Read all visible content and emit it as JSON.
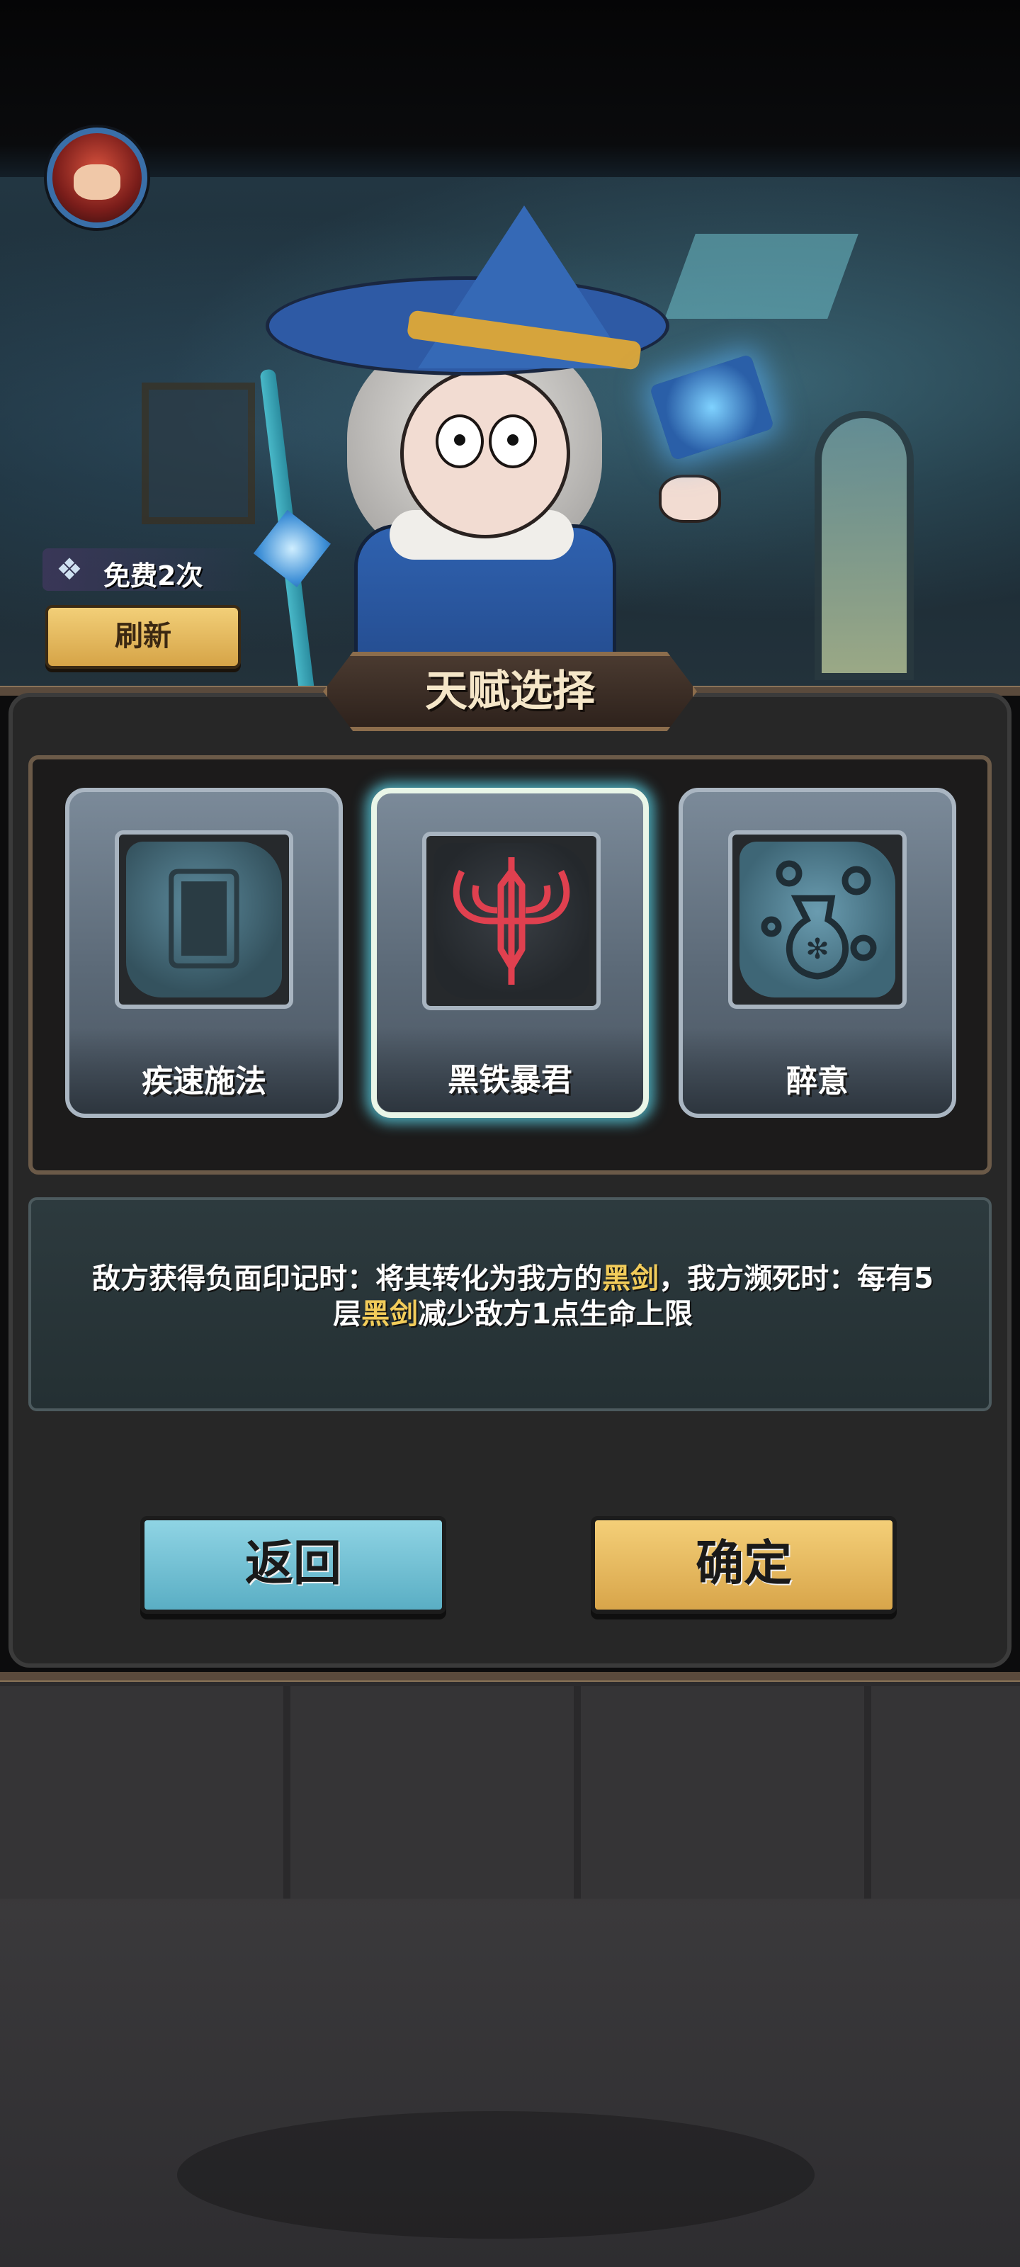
{
  "header": {
    "avatar_icon": "character-portrait-icon"
  },
  "refresh": {
    "free_icon": "ice-cube-icon",
    "free_text": "免费2次",
    "button_label": "刷新"
  },
  "panel": {
    "title": "天赋选择",
    "cards": [
      {
        "name": "疾速施法",
        "icon": "torn-cards-icon",
        "selected": false
      },
      {
        "name": "黑铁暴君",
        "icon": "horned-sword-icon",
        "selected": true
      },
      {
        "name": "醉意",
        "icon": "potion-swirl-icon",
        "selected": false
      }
    ],
    "description": {
      "part1": "敌方获得负面印记时：将其转化为我方的",
      "highlight1": "黑剑",
      "part2": "，我方濒死时：每有5层",
      "highlight2": "黑剑",
      "part3": "减少敌方1点生命上限"
    },
    "back_label": "返回",
    "confirm_label": "确定"
  },
  "colors": {
    "highlight": "#f2cc5a",
    "back_button": "#7cc6d8",
    "confirm_button": "#e8bb5e",
    "selected_glow": "#5ad2e6"
  }
}
